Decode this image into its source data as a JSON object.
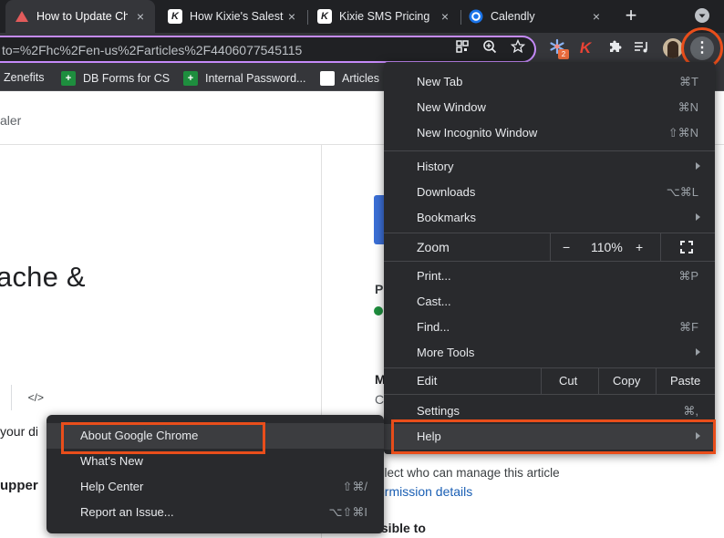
{
  "tabs": [
    {
      "title": "How to Update Ch",
      "favicon": "zendesk-icon",
      "active": true
    },
    {
      "title": "How Kixie's Salest",
      "favicon": "kixie-icon",
      "active": false
    },
    {
      "title": "Kixie SMS Pricing",
      "favicon": "kixie-icon",
      "active": false
    },
    {
      "title": "Calendly",
      "favicon": "calendly-icon",
      "active": false
    }
  ],
  "tab_close_glyph": "×",
  "new_tab_glyph": "+",
  "address_bar": {
    "url": "to=%2Fhc%2Fen-us%2Farticles%2F4406077545115"
  },
  "toolbar": {
    "extension_badge": "2",
    "kebab_glyph": "⋮"
  },
  "bookmarks": [
    {
      "label": "Zenefits",
      "icon": "none"
    },
    {
      "label": "DB Forms for CS",
      "icon": "sheets-icon"
    },
    {
      "label": "Internal Password...",
      "icon": "sheets-icon"
    },
    {
      "label": "Articles",
      "icon": "kixie-icon"
    }
  ],
  "page": {
    "breadcrumb": "aler",
    "heading": "ache &",
    "code_glyph": "</>",
    "text1": "your di",
    "text2": "upper",
    "right_p": "P",
    "right_m": "M",
    "right_c": "C",
    "select_text": "elect who can manage this article",
    "perm_link": "ermission details",
    "visible_text": "isible to"
  },
  "menu": {
    "items": [
      {
        "label": "New Tab",
        "shortcut": "⌘T"
      },
      {
        "label": "New Window",
        "shortcut": "⌘N"
      },
      {
        "label": "New Incognito Window",
        "shortcut": "⇧⌘N"
      },
      {
        "label": "History",
        "submenu": true
      },
      {
        "label": "Downloads",
        "shortcut": "⌥⌘L"
      },
      {
        "label": "Bookmarks",
        "submenu": true
      },
      {
        "label": "Print...",
        "shortcut": "⌘P"
      },
      {
        "label": "Cast..."
      },
      {
        "label": "Find...",
        "shortcut": "⌘F"
      },
      {
        "label": "More Tools",
        "submenu": true
      },
      {
        "label": "Settings",
        "shortcut": "⌘,"
      },
      {
        "label": "Help",
        "submenu": true
      }
    ],
    "zoom": {
      "label": "Zoom",
      "minus": "−",
      "level": "110%",
      "plus": "+"
    },
    "edit": {
      "label": "Edit",
      "cut": "Cut",
      "copy": "Copy",
      "paste": "Paste"
    }
  },
  "help_submenu": {
    "items": [
      {
        "label": "About Google Chrome"
      },
      {
        "label": "What's New"
      },
      {
        "label": "Help Center",
        "shortcut": "⇧⌘/"
      },
      {
        "label": "Report an Issue...",
        "shortcut": "⌥⇧⌘I"
      }
    ]
  },
  "colors": {
    "highlight": "#e94e1b",
    "menu_bg": "#292a2d",
    "accent_link": "#1a5fb4"
  }
}
